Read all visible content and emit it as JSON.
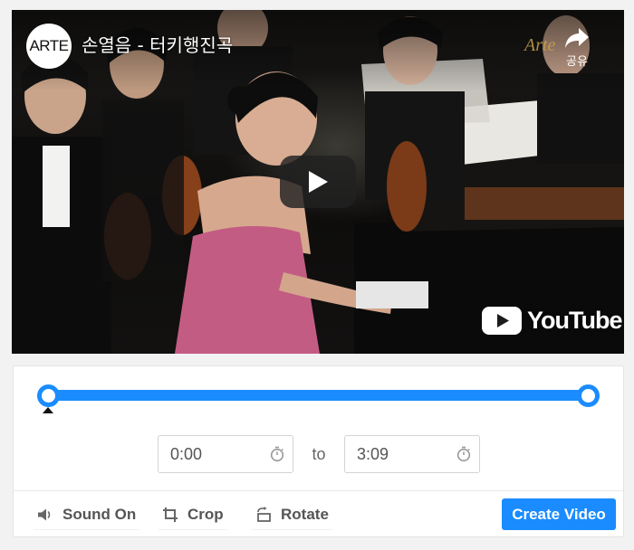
{
  "video": {
    "channel_logo_text": "ARTE",
    "title": "손열음 - 터키행진곡",
    "share_label": "공유",
    "watermark_text": "Arte",
    "brand": "YouTube",
    "icons": {
      "play": "play-icon",
      "share": "share-arrow-icon",
      "youtube": "youtube-logo-icon"
    }
  },
  "trim": {
    "start_fraction": 0.0,
    "end_fraction": 1.0,
    "playhead_fraction": 0.0,
    "colors": {
      "accent": "#1a8cff",
      "track": "#dfe8f3"
    }
  },
  "time_range": {
    "start_value": "0:00",
    "end_value": "3:09",
    "separator": "to",
    "icon": "stopwatch-icon"
  },
  "toolbar": {
    "sound_label": "Sound On",
    "crop_label": "Crop",
    "rotate_label": "Rotate",
    "create_label": "Create Video",
    "icons": {
      "sound": "speaker-icon",
      "crop": "crop-icon",
      "rotate": "rotate-icon"
    }
  }
}
